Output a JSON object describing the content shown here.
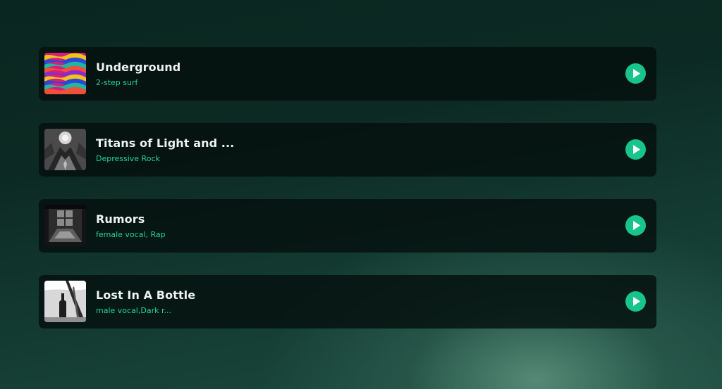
{
  "tracks": [
    {
      "title": "Underground",
      "tags": "2-step surf",
      "cover_icon": "psychedelic-waves-cover-icon",
      "action_icon": "play-icon"
    },
    {
      "title": "Titans of Light and ...",
      "tags": "Depressive Rock",
      "cover_icon": "dark-fantasy-cover-icon",
      "action_icon": "play-icon"
    },
    {
      "title": "Rumors",
      "tags": "female vocal, Rap",
      "cover_icon": "dark-room-cover-icon",
      "action_icon": "play-icon"
    },
    {
      "title": "Lost In A Bottle",
      "tags": "male vocal,Dark r...",
      "cover_icon": "bottle-cover-icon",
      "action_icon": "play-icon"
    }
  ],
  "colors": {
    "accent": "#16c48c",
    "tag_text": "#1fd69a",
    "title_text": "#eef3f1",
    "card_bg": "#05100e"
  }
}
